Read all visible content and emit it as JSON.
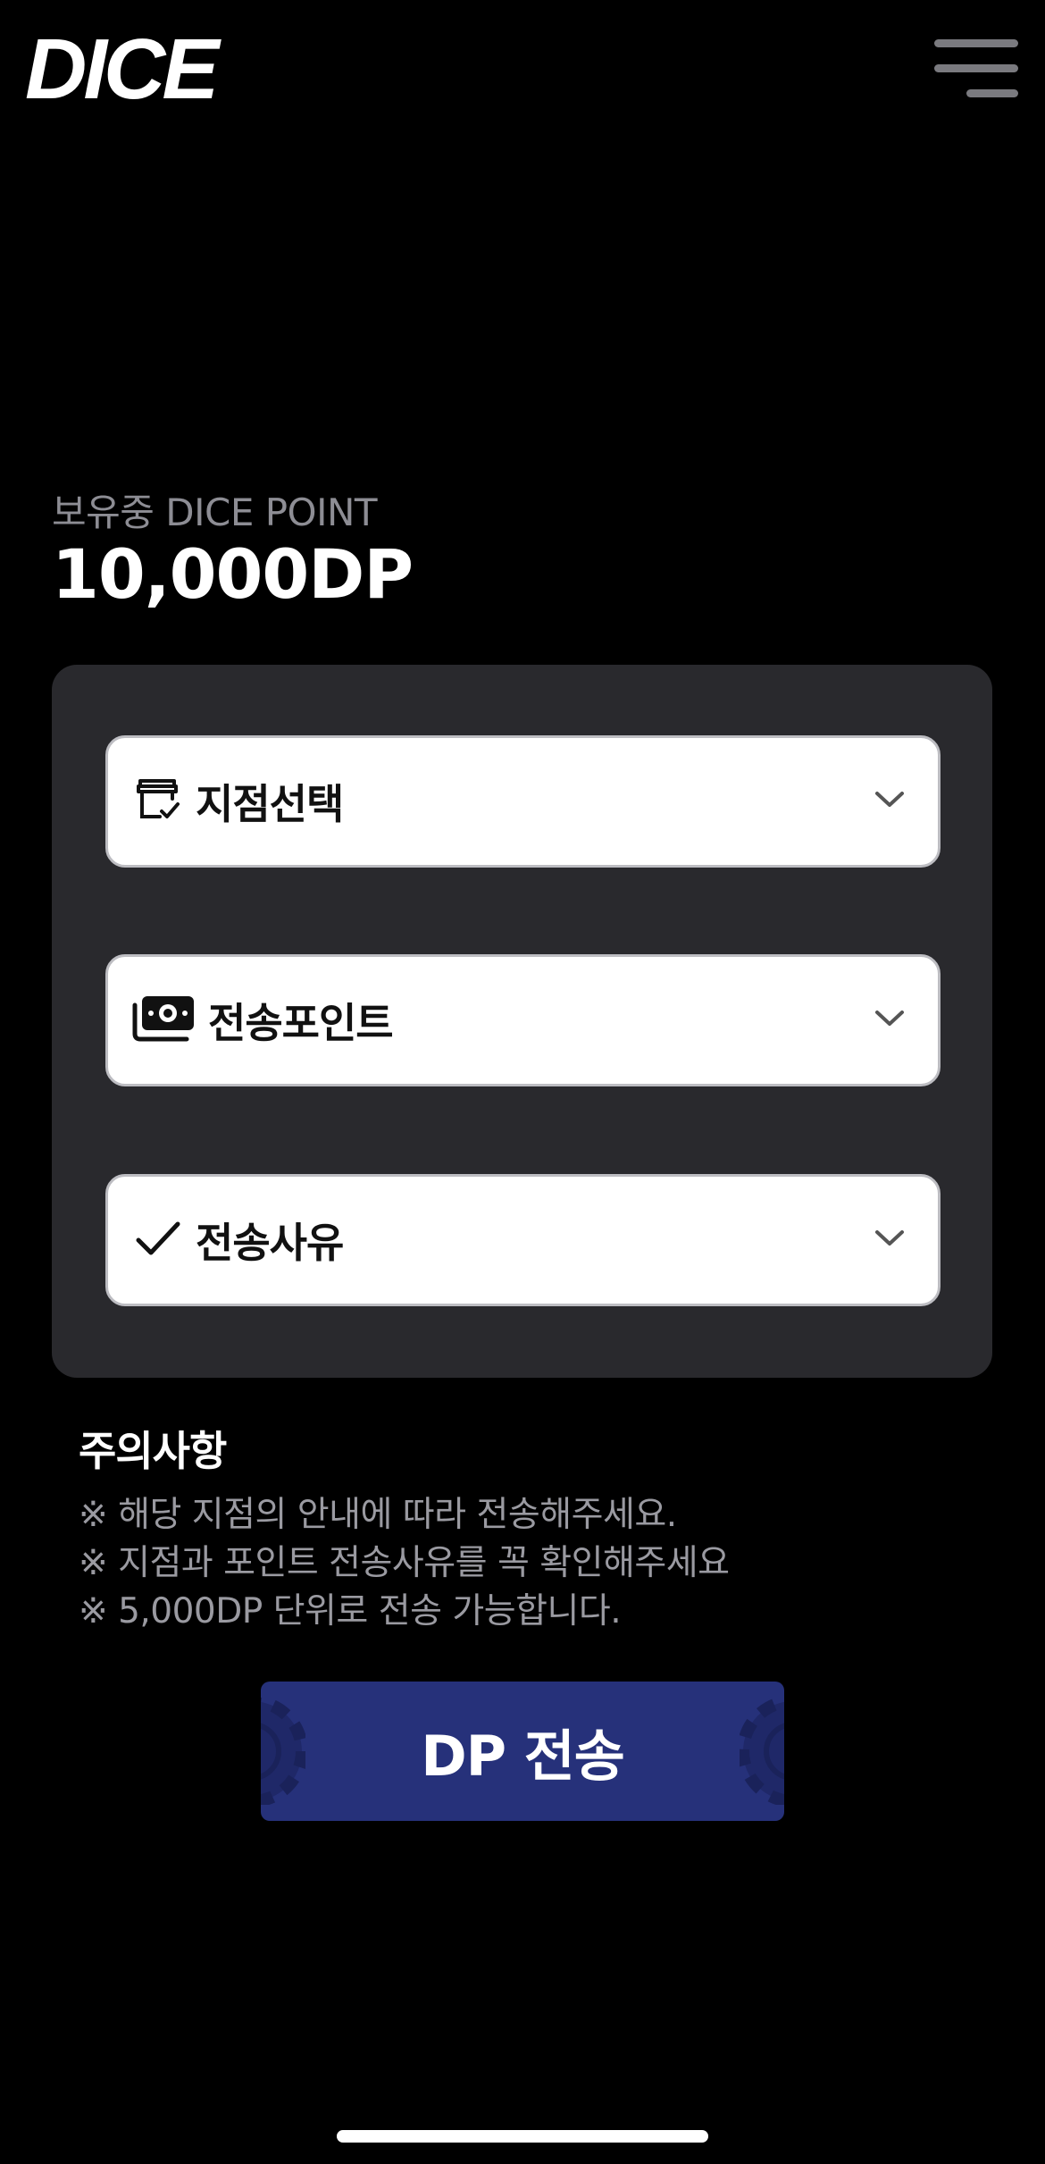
{
  "header": {
    "logo_text": "DICE",
    "menu_icon": "hamburger-menu-icon"
  },
  "balance": {
    "label": "보유중 DICE POINT",
    "value": "10,000DP"
  },
  "form": {
    "fields": [
      {
        "label": "지점선택",
        "icon": "store-check-icon"
      },
      {
        "label": "전송포인트",
        "icon": "cash-icon"
      },
      {
        "label": "전송사유",
        "icon": "checkmark-icon"
      }
    ]
  },
  "notice": {
    "title": "주의사항",
    "lines": [
      "※ 해당 지점의 안내에 따라 전송해주세요.",
      "※ 지점과 포인트 전송사유를 꼭 확인해주세요",
      "※ 5,000DP 단위로 전송 가능합니다."
    ]
  },
  "submit": {
    "label": "DP 전송"
  },
  "colors": {
    "background": "#000000",
    "panel": "#29292d",
    "button": "#26317a",
    "muted_text": "#8d8d94"
  }
}
